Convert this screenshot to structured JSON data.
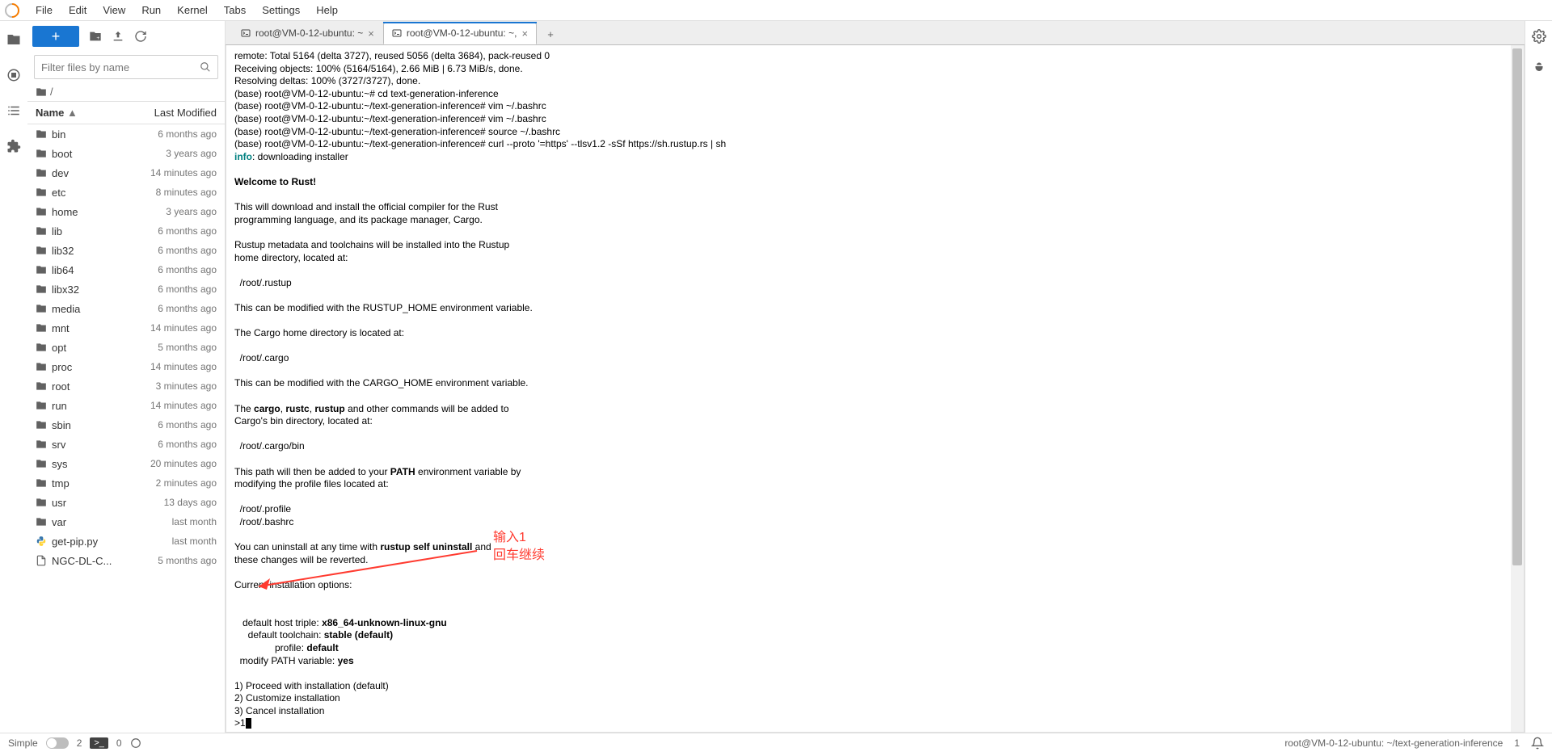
{
  "menu": [
    "File",
    "Edit",
    "View",
    "Run",
    "Kernel",
    "Tabs",
    "Settings",
    "Help"
  ],
  "filter_placeholder": "Filter files by name",
  "breadcrumb_sep": "/",
  "fp_header": {
    "name": "Name",
    "mod": "Last Modified"
  },
  "files": [
    {
      "icon": "folder",
      "name": "bin",
      "mod": "6 months ago"
    },
    {
      "icon": "folder",
      "name": "boot",
      "mod": "3 years ago"
    },
    {
      "icon": "folder",
      "name": "dev",
      "mod": "14 minutes ago"
    },
    {
      "icon": "folder",
      "name": "etc",
      "mod": "8 minutes ago"
    },
    {
      "icon": "folder",
      "name": "home",
      "mod": "3 years ago"
    },
    {
      "icon": "folder",
      "name": "lib",
      "mod": "6 months ago"
    },
    {
      "icon": "folder",
      "name": "lib32",
      "mod": "6 months ago"
    },
    {
      "icon": "folder",
      "name": "lib64",
      "mod": "6 months ago"
    },
    {
      "icon": "folder",
      "name": "libx32",
      "mod": "6 months ago"
    },
    {
      "icon": "folder",
      "name": "media",
      "mod": "6 months ago"
    },
    {
      "icon": "folder",
      "name": "mnt",
      "mod": "14 minutes ago"
    },
    {
      "icon": "folder",
      "name": "opt",
      "mod": "5 months ago"
    },
    {
      "icon": "folder",
      "name": "proc",
      "mod": "14 minutes ago"
    },
    {
      "icon": "folder",
      "name": "root",
      "mod": "3 minutes ago"
    },
    {
      "icon": "folder",
      "name": "run",
      "mod": "14 minutes ago"
    },
    {
      "icon": "folder",
      "name": "sbin",
      "mod": "6 months ago"
    },
    {
      "icon": "folder",
      "name": "srv",
      "mod": "6 months ago"
    },
    {
      "icon": "folder",
      "name": "sys",
      "mod": "20 minutes ago"
    },
    {
      "icon": "folder",
      "name": "tmp",
      "mod": "2 minutes ago"
    },
    {
      "icon": "folder",
      "name": "usr",
      "mod": "13 days ago"
    },
    {
      "icon": "folder",
      "name": "var",
      "mod": "last month"
    },
    {
      "icon": "py",
      "name": "get-pip.py",
      "mod": "last month"
    },
    {
      "icon": "file",
      "name": "NGC-DL-C...",
      "mod": "5 months ago"
    }
  ],
  "tabs": [
    {
      "label": "root@VM-0-12-ubuntu: ~",
      "active": false
    },
    {
      "label": "root@VM-0-12-ubuntu: ~,",
      "active": true
    }
  ],
  "terminal": {
    "l1": "remote: Total 5164 (delta 3727), reused 5056 (delta 3684), pack-reused 0",
    "l2": "Receiving objects: 100% (5164/5164), 2.66 MiB | 6.73 MiB/s, done.",
    "l3": "Resolving deltas: 100% (3727/3727), done.",
    "p1_a": "(base) root@VM-0-12-ubuntu:~# cd text-generation-inference",
    "p2_a": "(base) root@VM-0-12-ubuntu:~/text-generation-inference# vim ~/.bashrc",
    "p3_a": "(base) root@VM-0-12-ubuntu:~/text-generation-inference# vim ~/.bashrc",
    "p4_a": "(base) root@VM-0-12-ubuntu:~/text-generation-inference# source ~/.bashrc",
    "p5_a": "(base) root@VM-0-12-ubuntu:~/text-generation-inference# curl --proto '=https' --tlsv1.2 -sSf https://sh.rustup.rs | sh",
    "info_label": "info",
    "info_rest": ": downloading installer",
    "welcome": "Welcome to Rust!",
    "desc1": "This will download and install the official compiler for the Rust",
    "desc2": "programming language, and its package manager, Cargo.",
    "meta1": "Rustup metadata and toolchains will be installed into the Rustup",
    "meta2": "home directory, located at:",
    "path1": "  /root/.rustup",
    "mod1": "This can be modified with the RUSTUP_HOME environment variable.",
    "cargo1": "The Cargo home directory is located at:",
    "path2": "  /root/.cargo",
    "mod2": "This can be modified with the CARGO_HOME environment variable.",
    "cmds_pre": "The ",
    "cmds_c1": "cargo",
    "cmds_s": ", ",
    "cmds_c2": "rustc",
    "cmds_c3": "rustup",
    "cmds_post": " and other commands will be added to",
    "cmds_line2": "Cargo's bin directory, located at:",
    "path3": "  /root/.cargo/bin",
    "path_pre": "This path will then be added to your ",
    "path_b": "PATH",
    "path_post": " environment variable by",
    "path_line2": "modifying the profile files located at:",
    "prof1": "  /root/.profile",
    "prof2": "  /root/.bashrc",
    "unins_pre": "You can uninstall at any time with ",
    "unins_b": "rustup self uninstall",
    "unins_post": " and",
    "unins_line2": "these changes will be reverted.",
    "curopt": "Current installation options:",
    "opt1_k": "   default host triple: ",
    "opt1_v": "x86_64-unknown-linux-gnu",
    "opt2_k": "     default toolchain: ",
    "opt2_v": "stable (default)",
    "opt3_k": "               profile: ",
    "opt3_v": "default",
    "opt4_k": "  modify PATH variable: ",
    "opt4_v": "yes",
    "choice1": "1) Proceed with installation (default)",
    "choice2": "2) Customize installation",
    "choice3": "3) Cancel installation",
    "prompt": ">1"
  },
  "annotation": {
    "line1": "输入1",
    "line2": "回车继续"
  },
  "status": {
    "simple": "Simple",
    "count": "2",
    "term_badge": ">_",
    "zero": "0",
    "path": "root@VM-0-12-ubuntu: ~/text-generation-inference",
    "one": "1"
  }
}
